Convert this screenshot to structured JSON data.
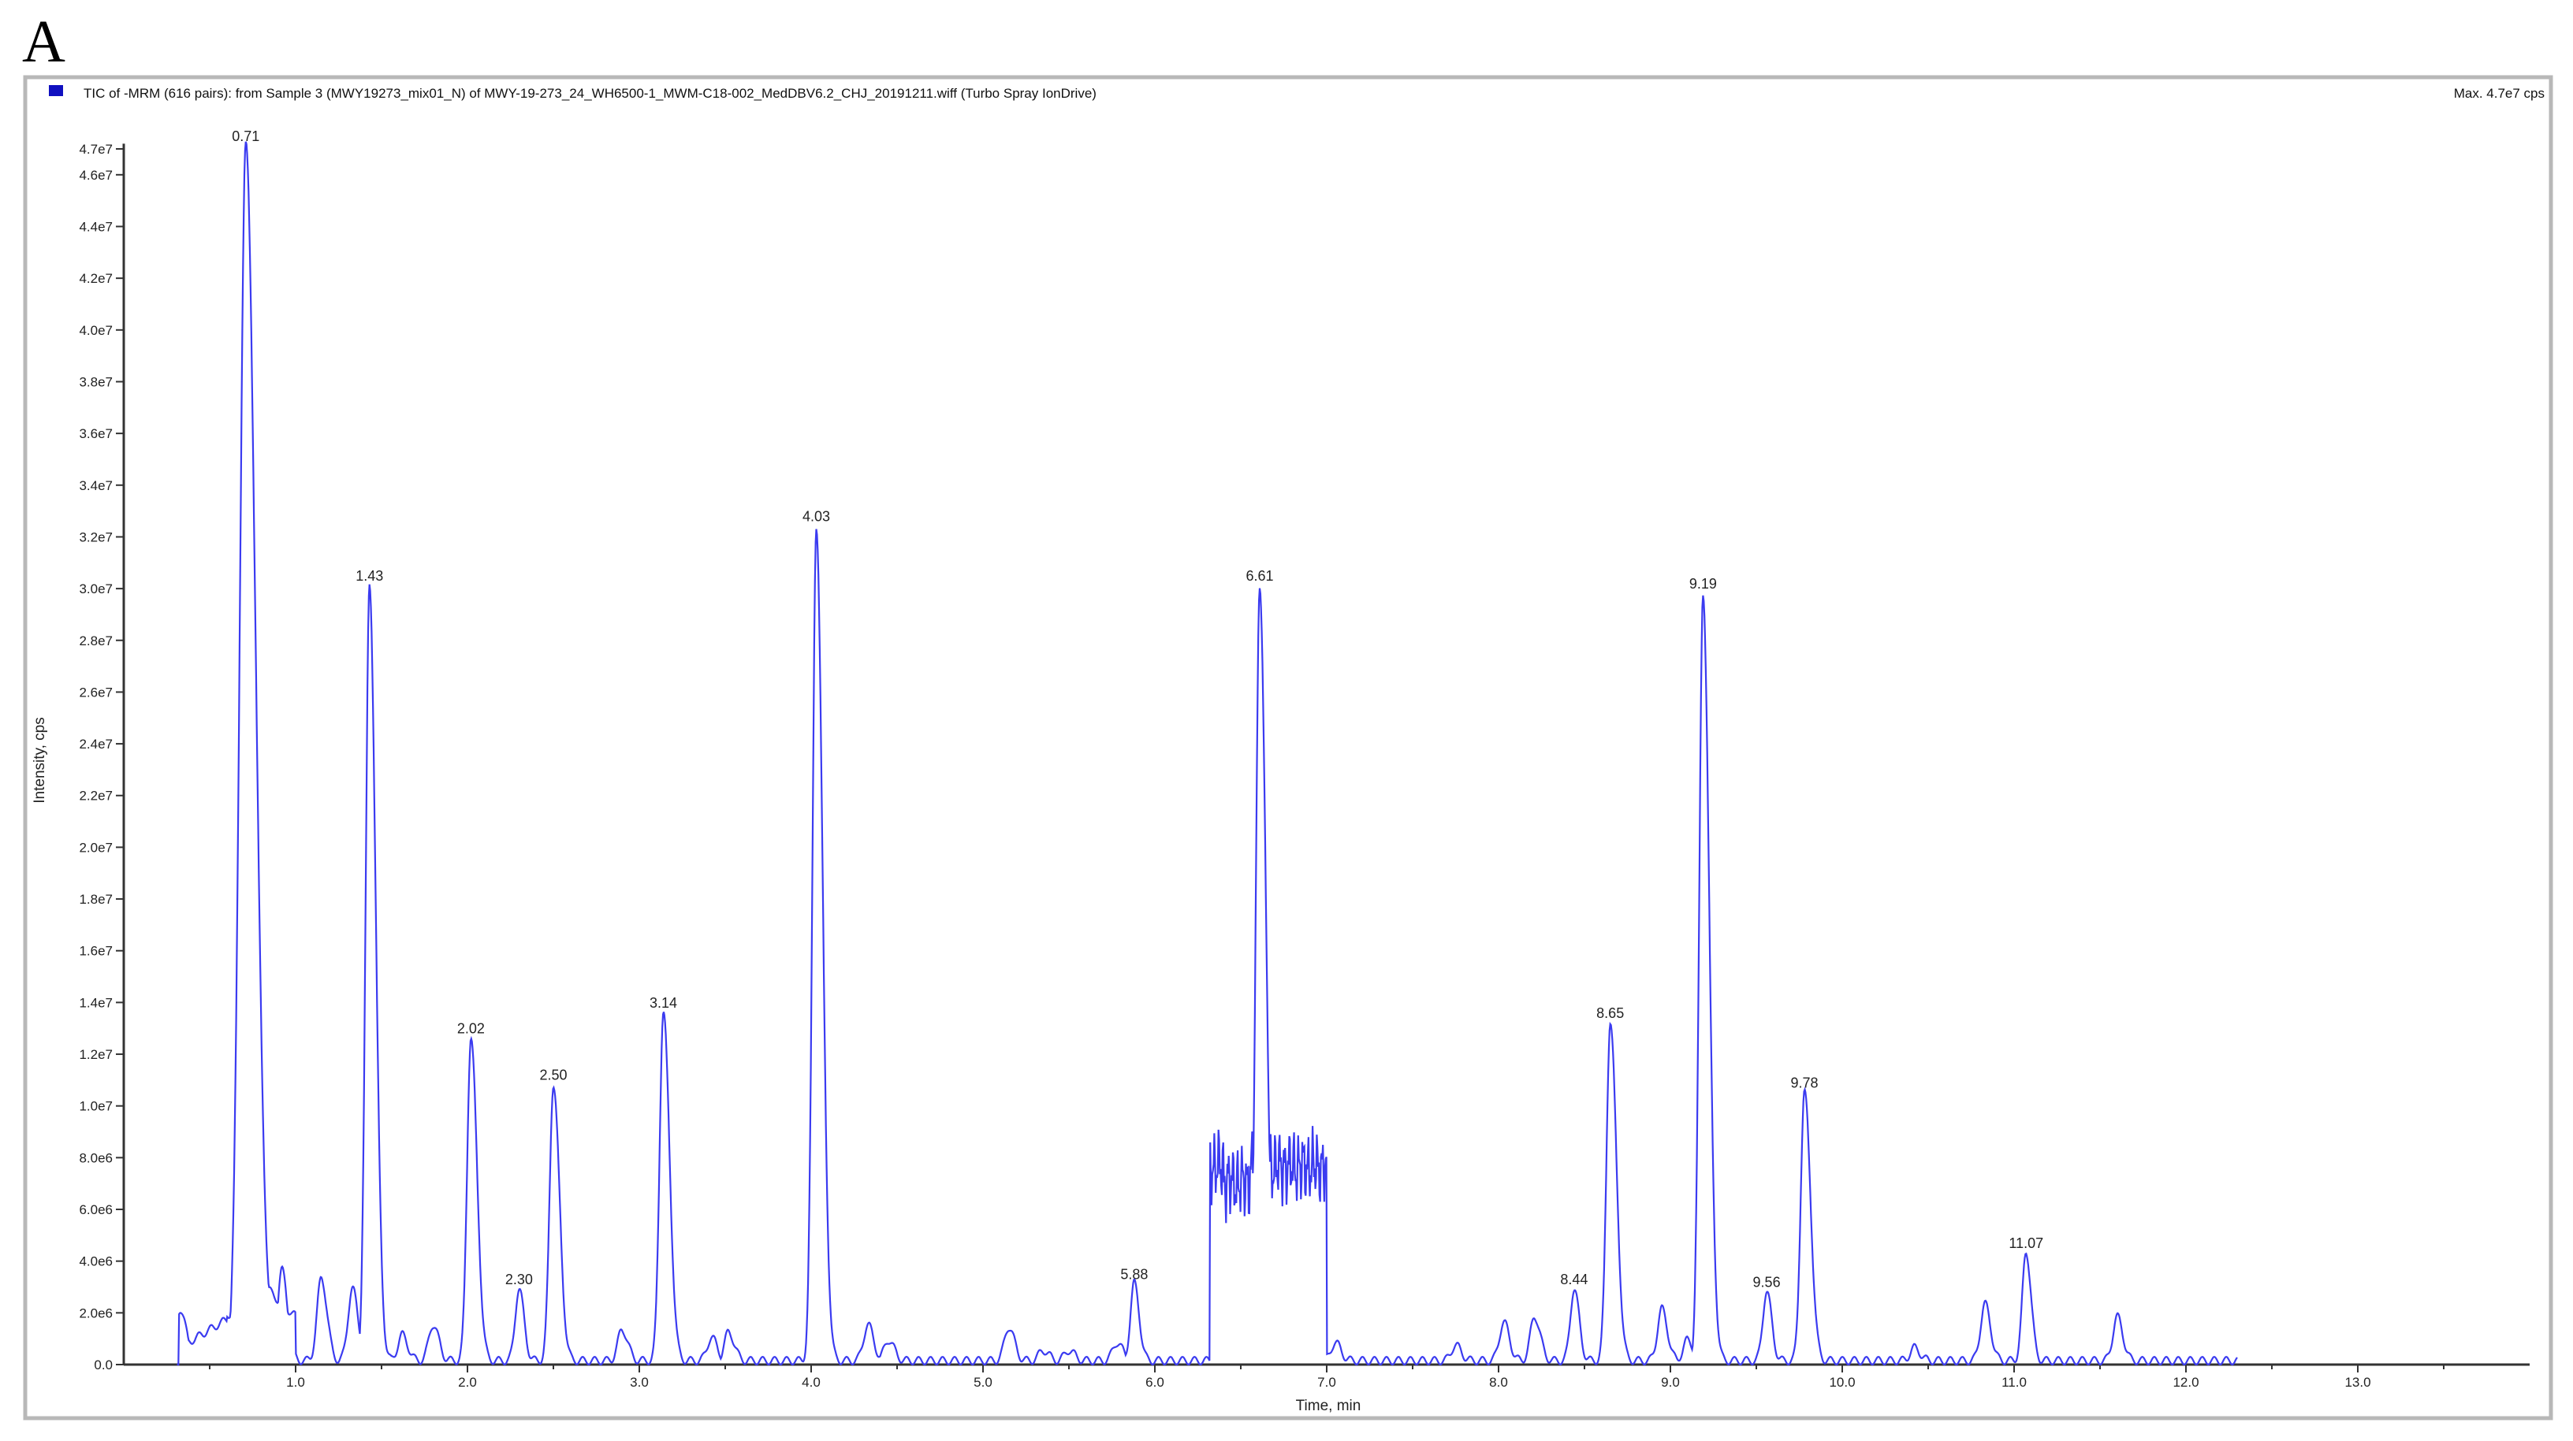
{
  "panel_label": "A",
  "chart_data": {
    "type": "line",
    "title": "TIC of -MRM (616 pairs): from Sample 3 (MWY19273_mix01_N) of MWY-19-273_24_WH6500-1_MWM-C18-002_MedDBV6.2_CHJ_20191211.wiff (Turbo Spray IonDrive)",
    "max_label": "Max. 4.7e7 cps",
    "xlabel": "Time, min",
    "ylabel": "Intensity, cps",
    "xlim": [
      0,
      14
    ],
    "ylim": [
      0,
      47000000
    ],
    "grid": false,
    "series_color": "#3b3bf0",
    "legend_color": "#1010c0",
    "x_ticks": [
      "1.0",
      "2.0",
      "3.0",
      "4.0",
      "5.0",
      "6.0",
      "7.0",
      "8.0",
      "9.0",
      "10.0",
      "11.0",
      "12.0",
      "13.0"
    ],
    "y_ticks": [
      "0.0",
      "2.0e6",
      "4.0e6",
      "6.0e6",
      "8.0e6",
      "1.0e7",
      "1.2e7",
      "1.4e7",
      "1.6e7",
      "1.8e7",
      "2.0e7",
      "2.2e7",
      "2.4e7",
      "2.6e7",
      "2.8e7",
      "3.0e7",
      "3.2e7",
      "3.4e7",
      "3.6e7",
      "3.8e7",
      "4.0e7",
      "4.2e7",
      "4.4e7",
      "4.6e7",
      "4.7e7"
    ],
    "labeled_peaks": [
      {
        "label": "0.71",
        "rt": 0.71,
        "intensity": 47000000
      },
      {
        "label": "1.43",
        "rt": 1.43,
        "intensity": 30000000
      },
      {
        "label": "2.02",
        "rt": 2.02,
        "intensity": 12500000
      },
      {
        "label": "2.30",
        "rt": 2.3,
        "intensity": 2800000
      },
      {
        "label": "2.50",
        "rt": 2.5,
        "intensity": 10700000
      },
      {
        "label": "3.14",
        "rt": 3.14,
        "intensity": 13500000
      },
      {
        "label": "4.03",
        "rt": 4.03,
        "intensity": 32300000
      },
      {
        "label": "5.88",
        "rt": 5.88,
        "intensity": 3000000
      },
      {
        "label": "6.61",
        "rt": 6.61,
        "intensity": 30000000
      },
      {
        "label": "8.44",
        "rt": 8.44,
        "intensity": 2800000
      },
      {
        "label": "8.65",
        "rt": 8.65,
        "intensity": 13100000
      },
      {
        "label": "9.19",
        "rt": 9.19,
        "intensity": 29700000
      },
      {
        "label": "9.56",
        "rt": 9.56,
        "intensity": 2700000
      },
      {
        "label": "9.78",
        "rt": 9.78,
        "intensity": 10400000
      },
      {
        "label": "11.07",
        "rt": 11.07,
        "intensity": 4200000
      }
    ],
    "minor_peaks": [
      {
        "rt": 0.33,
        "intensity": 2000000
      },
      {
        "rt": 0.92,
        "intensity": 3500000
      },
      {
        "rt": 1.15,
        "intensity": 3200000
      },
      {
        "rt": 1.33,
        "intensity": 2800000
      },
      {
        "rt": 1.62,
        "intensity": 1000000
      },
      {
        "rt": 1.8,
        "intensity": 1400000
      },
      {
        "rt": 2.9,
        "intensity": 1200000
      },
      {
        "rt": 3.42,
        "intensity": 900000
      },
      {
        "rt": 3.52,
        "intensity": 1100000
      },
      {
        "rt": 4.33,
        "intensity": 1400000
      },
      {
        "rt": 4.45,
        "intensity": 800000
      },
      {
        "rt": 5.15,
        "intensity": 1300000
      },
      {
        "rt": 5.35,
        "intensity": 400000
      },
      {
        "rt": 5.5,
        "intensity": 400000
      },
      {
        "rt": 5.78,
        "intensity": 700000
      },
      {
        "rt": 7.05,
        "intensity": 700000
      },
      {
        "rt": 7.75,
        "intensity": 600000
      },
      {
        "rt": 8.03,
        "intensity": 1500000
      },
      {
        "rt": 8.21,
        "intensity": 1700000
      },
      {
        "rt": 8.95,
        "intensity": 2000000
      },
      {
        "rt": 9.1,
        "intensity": 800000
      },
      {
        "rt": 10.42,
        "intensity": 500000
      },
      {
        "rt": 10.83,
        "intensity": 2200000
      },
      {
        "rt": 11.6,
        "intensity": 1700000
      }
    ],
    "plateau": {
      "start": 6.32,
      "end": 7.0,
      "intensity": 7500000
    }
  }
}
